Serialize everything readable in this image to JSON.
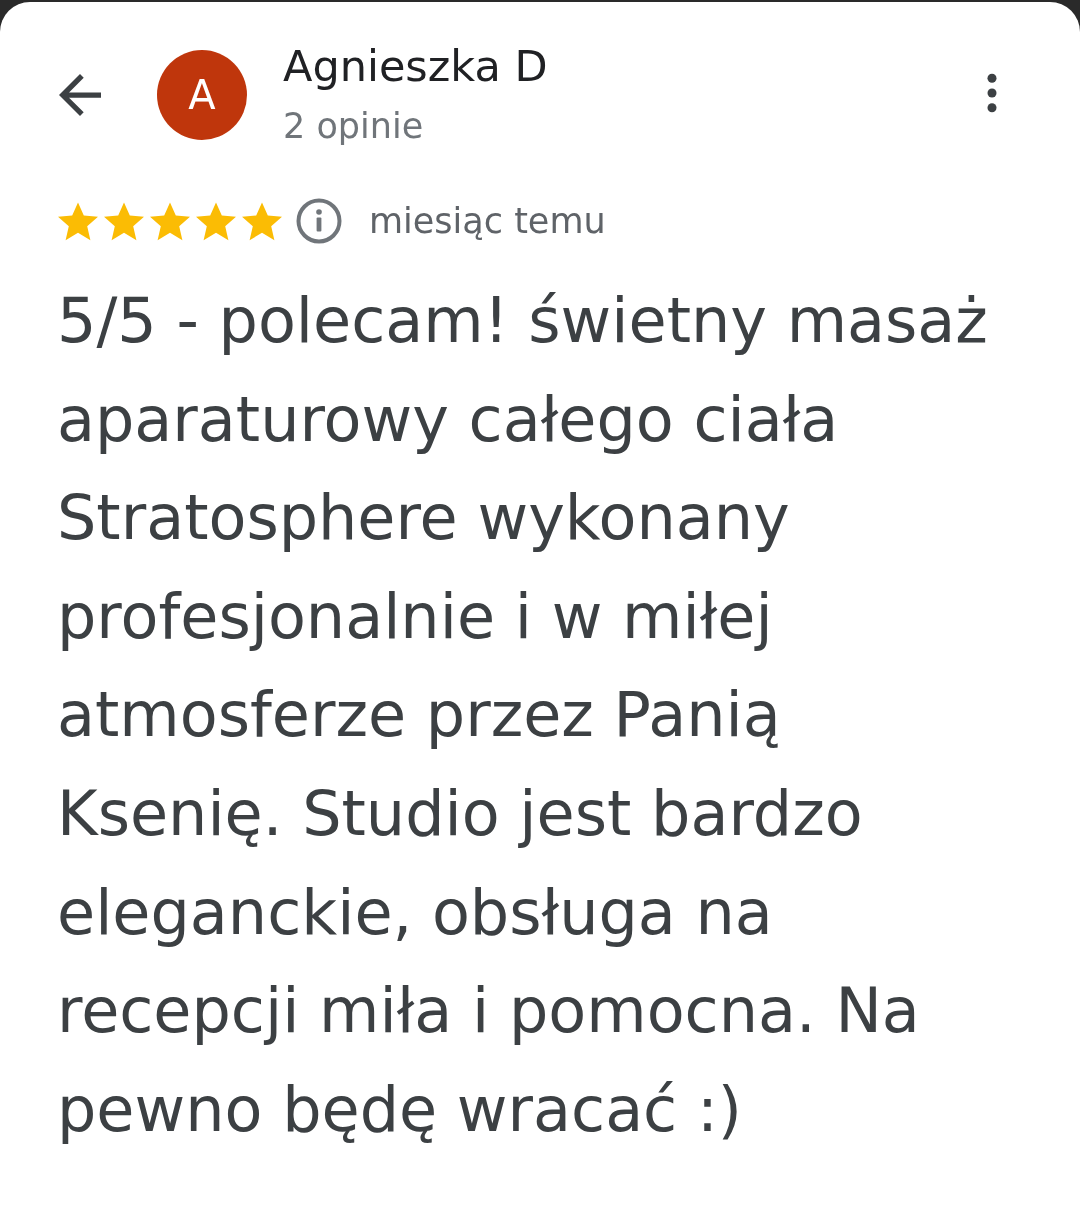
{
  "reviewer": {
    "initial": "A",
    "name": "Agnieszka D",
    "review_count": "2 opinie"
  },
  "review": {
    "stars": 5,
    "time": "miesiąc temu",
    "text": "5/5 - polecam! świetny masaż aparaturowy całego ciała Stratosphere wykonany profesjonalnie i w miłej atmosferze przez Panią Ksenię. Studio jest bardzo eleganckie, obsługa na recepcji miła i pomocna. Na pewno będę wracać :)"
  }
}
